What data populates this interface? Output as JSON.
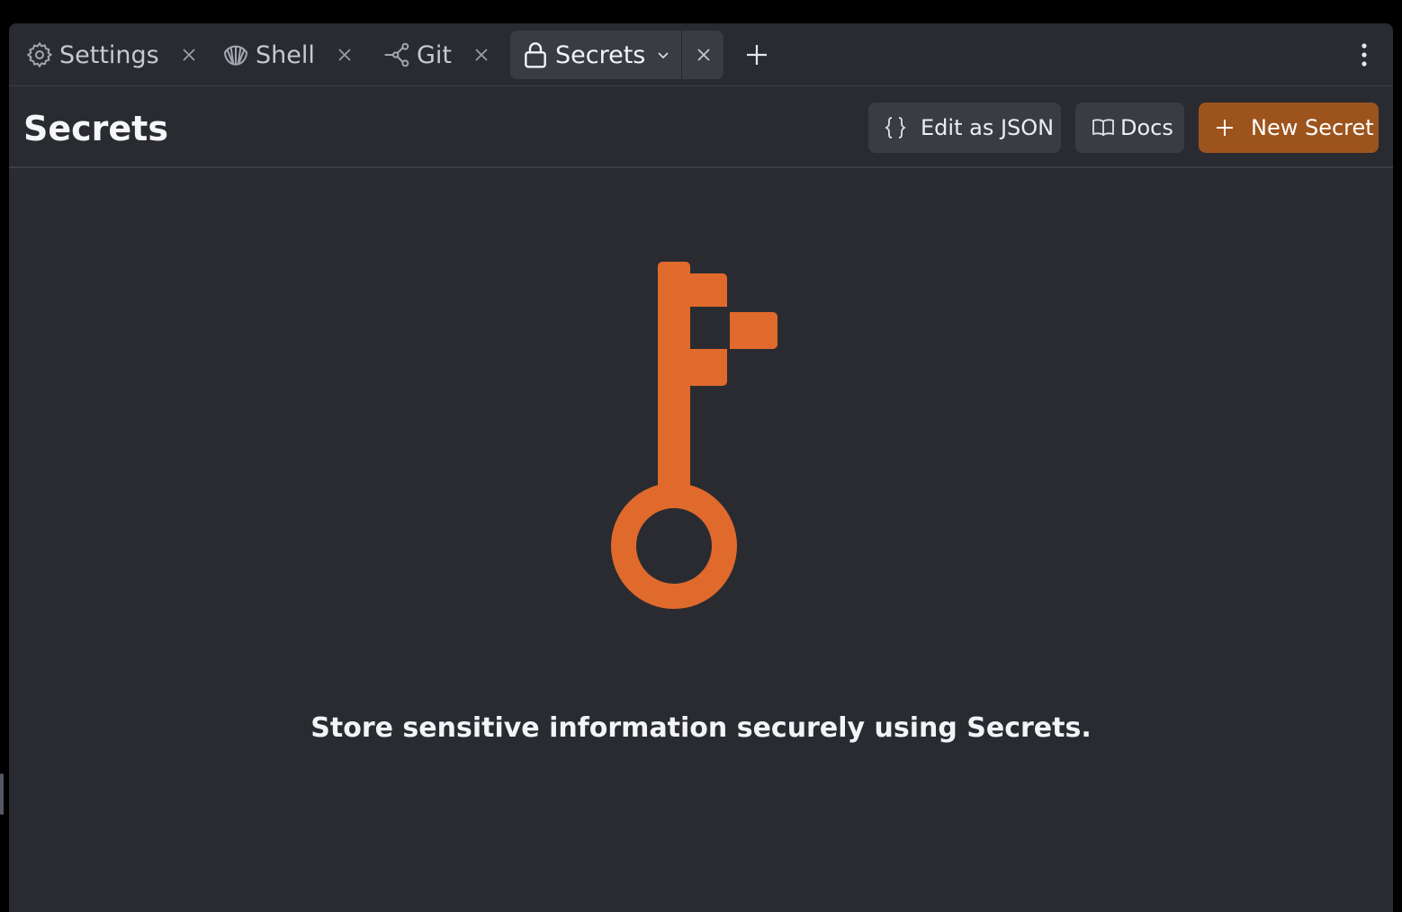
{
  "tabs": [
    {
      "label": "Settings",
      "icon": "gear-icon",
      "active": false
    },
    {
      "label": "Shell",
      "icon": "shell-icon",
      "active": false
    },
    {
      "label": "Git",
      "icon": "git-branch-icon",
      "active": false
    },
    {
      "label": "Secrets",
      "icon": "lock-icon",
      "active": true
    }
  ],
  "header": {
    "title": "Secrets",
    "edit_json_label": "Edit as JSON",
    "docs_label": "Docs",
    "new_secret_label": "New Secret"
  },
  "empty_state": {
    "message": "Store sensitive information securely using Secrets."
  },
  "colors": {
    "background": "#2a2b31",
    "accent": "#e06a2c",
    "primary_button": "#9d541c"
  }
}
